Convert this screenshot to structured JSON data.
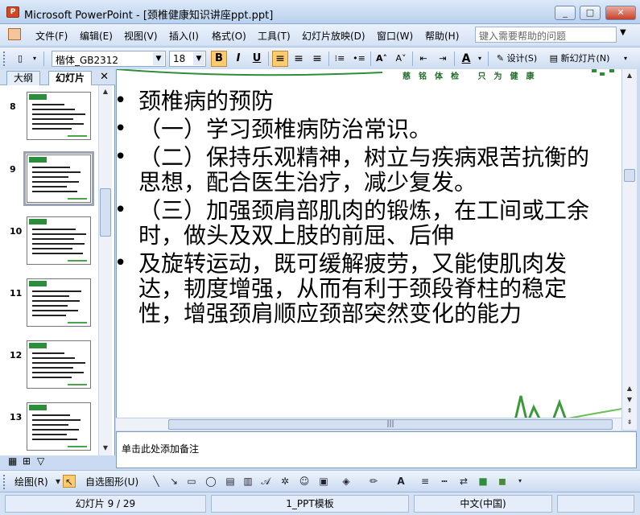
{
  "window": {
    "app_icon_label": "P",
    "title": "Microsoft PowerPoint - [颈椎健康知识讲座ppt.ppt]",
    "min": "_",
    "max": "□",
    "close": "✕"
  },
  "menu": {
    "items": [
      "文件(F)",
      "编辑(E)",
      "视图(V)",
      "插入(I)",
      "格式(O)",
      "工具(T)",
      "幻灯片放映(D)",
      "窗口(W)",
      "帮助(H)"
    ],
    "help_placeholder": "键入需要帮助的问题"
  },
  "toolbar": {
    "font_name": "楷体_GB2312",
    "font_size": "18",
    "bold": "B",
    "italic": "I",
    "underline": "U",
    "font_color_label": "A",
    "design_label": "设计(S)",
    "new_slide_label": "新幻灯片(N)"
  },
  "panel": {
    "tabs": [
      "大纲",
      "幻灯片"
    ],
    "active_tab": "幻灯片",
    "close": "✕",
    "thumbnails": [
      {
        "number": "8",
        "selected": false
      },
      {
        "number": "9",
        "selected": true
      },
      {
        "number": "10",
        "selected": false
      },
      {
        "number": "11",
        "selected": false
      },
      {
        "number": "12",
        "selected": false
      },
      {
        "number": "13",
        "selected": false
      }
    ]
  },
  "slide": {
    "slogan": "慈铭体检 只为健康",
    "bullets": [
      "颈椎病的预防",
      "（一）学习颈椎病防治常识。",
      "（二）保持乐观精神，树立与疾病艰苦抗衡的思想，配合医生治疗，减少复发。",
      "（三）加强颈肩部肌肉的锻炼，在工间或工余时，做头及双上肢的前屈、后伸",
      "及旋转运动，既可缓解疲劳，又能使肌肉发达，韧度增强，从而有利于颈段脊柱的稳定性，增强颈肩顺应颈部突然变化的能力"
    ],
    "accent_color": "#2b8e3a"
  },
  "notes": {
    "placeholder": "单击此处添加备注"
  },
  "drawbar": {
    "draw_label": "绘图(R)",
    "autoshape_label": "自选图形(U)"
  },
  "status": {
    "slide_counter": "幻灯片 9 / 29",
    "template": "1_PPT模板",
    "language": "中文(中国)"
  }
}
